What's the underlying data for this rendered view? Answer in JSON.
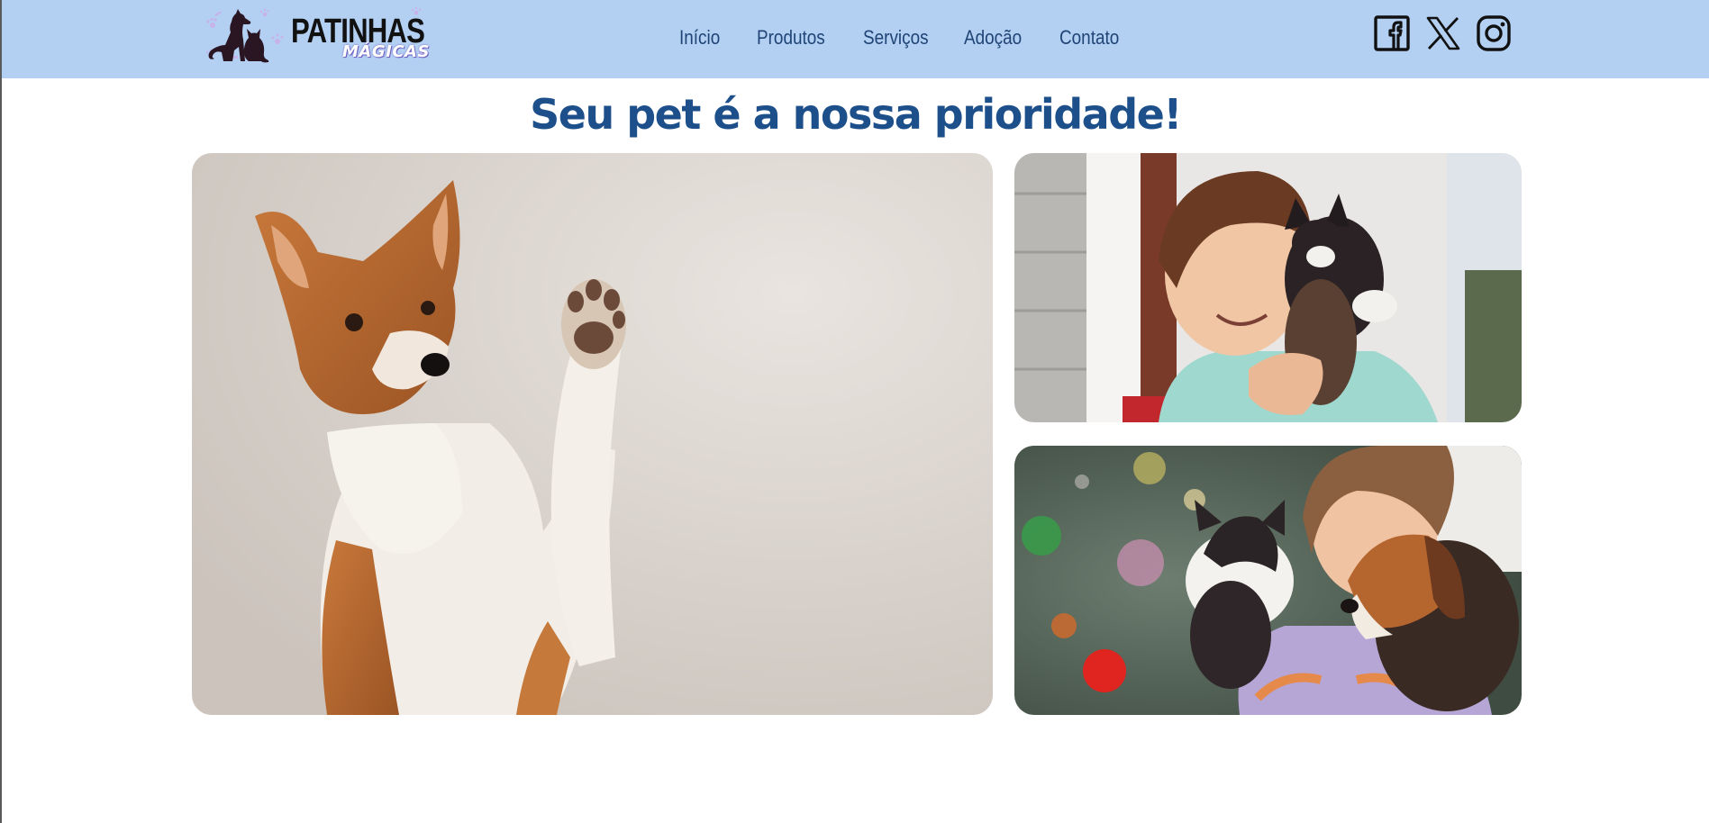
{
  "brand": {
    "name": "PATINHAS",
    "tagline": "MÁGICAS"
  },
  "nav": {
    "items": [
      {
        "label": "Início"
      },
      {
        "label": "Produtos"
      },
      {
        "label": "Serviços"
      },
      {
        "label": "Adoção"
      },
      {
        "label": "Contato"
      }
    ]
  },
  "social": {
    "icons": [
      "facebook-icon",
      "x-twitter-icon",
      "instagram-icon"
    ]
  },
  "hero": {
    "title": "Seu pet é a nossa prioridade!"
  },
  "colors": {
    "header_bg": "#b3d0f3",
    "nav_text": "#1f4475",
    "title": "#1d4f8a"
  }
}
